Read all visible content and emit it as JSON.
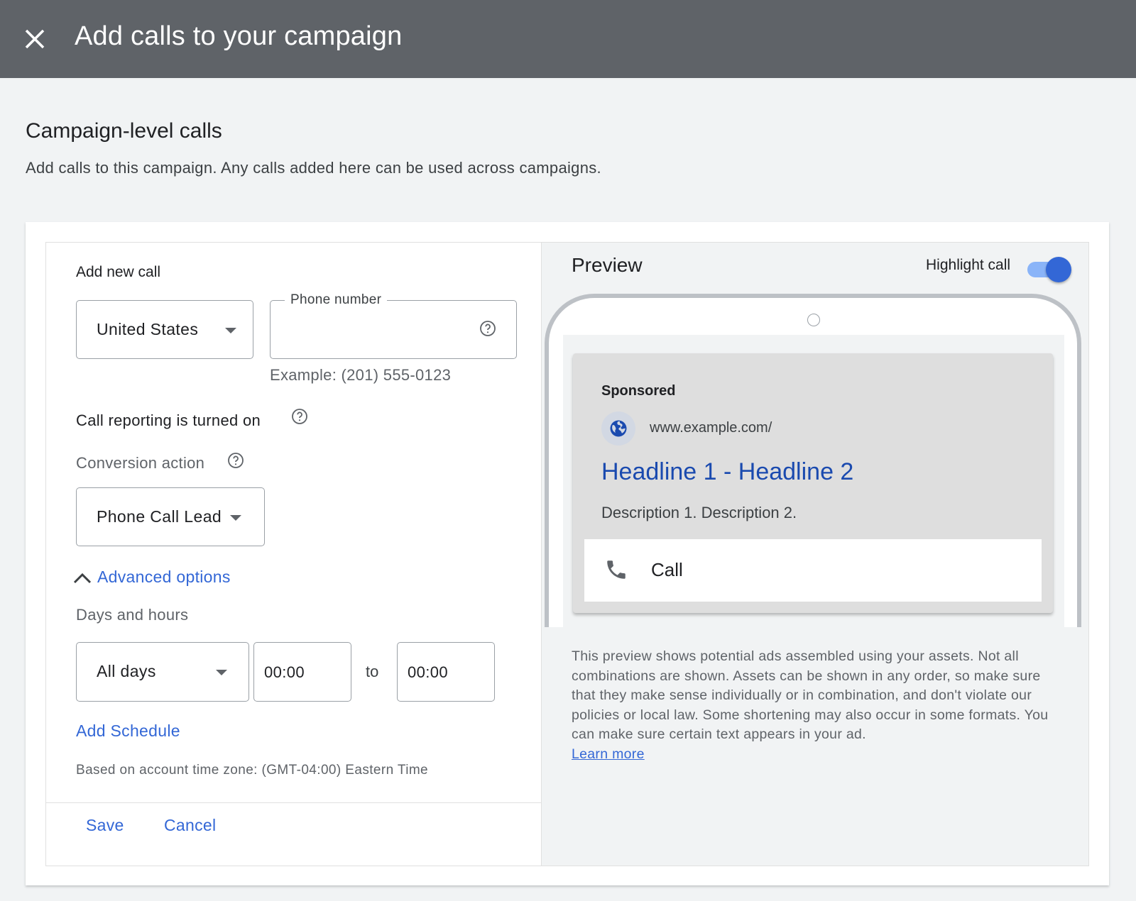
{
  "header": {
    "title": "Add calls to your campaign",
    "close_icon": "close-icon"
  },
  "section": {
    "title": "Campaign-level calls",
    "description": "Add calls to this campaign. Any calls added here can be used across campaigns."
  },
  "form": {
    "heading": "Add new call",
    "country": {
      "value": "United States"
    },
    "phone": {
      "label": "Phone number",
      "value": "",
      "placeholder": "",
      "help_icon": "help-circle-icon"
    },
    "phone_example": "Example: (201) 555-0123",
    "call_reporting": "Call reporting is turned on",
    "conversion_label": "Conversion action",
    "conversion_value": "Phone Call Lead",
    "advanced_options": "Advanced options",
    "days_hours_label": "Days and hours",
    "days_value": "All days",
    "start_time": "00:00",
    "to_label": "to",
    "end_time": "00:00",
    "add_schedule": "Add Schedule",
    "timezone_note": "Based on account time zone: (GMT-04:00) Eastern Time",
    "save_label": "Save",
    "cancel_label": "Cancel"
  },
  "preview": {
    "title": "Preview",
    "highlight_label": "Highlight call",
    "highlight_on": true,
    "ad": {
      "sponsored": "Sponsored",
      "url": "www.example.com/",
      "headline": "Headline 1 - Headline 2",
      "description": "Description 1. Description 2.",
      "call_label": "Call"
    },
    "disclaimer": "This preview shows potential ads assembled using your assets. Not all combinations are shown. Assets can be shown in any order, so make sure that they make sense individually or in combination, and don't violate our policies or local law. Some shortening may also occur in some formats. You can make sure certain text appears in your ad.",
    "learn_more": "Learn more"
  },
  "colors": {
    "header_bg": "#5f6368",
    "link": "#3367d6",
    "headline": "#1a4aaf",
    "toggle_on": "#3367d6"
  }
}
